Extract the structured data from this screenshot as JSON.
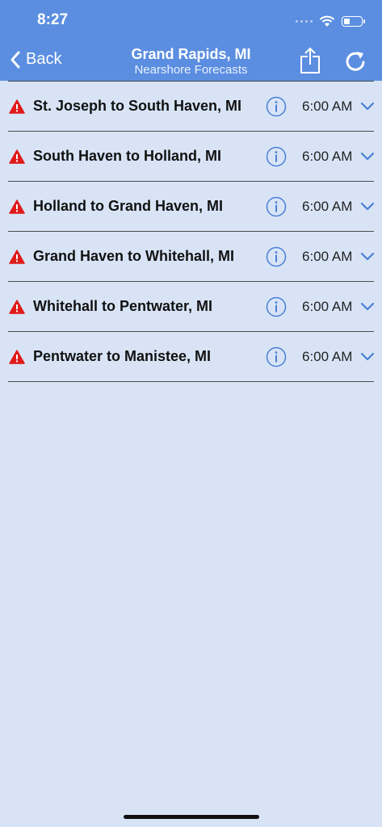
{
  "status_bar": {
    "time": "8:27",
    "battery_level": 0.35
  },
  "nav": {
    "back_label": "Back",
    "title": "Grand Rapids, MI",
    "subtitle": "Nearshore Forecasts"
  },
  "colors": {
    "header": "#5b8ee0",
    "background": "#d8e4f6",
    "accent": "#4a7fd6",
    "warning": "#e01b1b"
  },
  "forecasts": [
    {
      "label": "St. Joseph to South Haven, MI",
      "time": "6:00 AM",
      "icon": "warning-icon"
    },
    {
      "label": "South Haven to Holland, MI",
      "time": "6:00 AM",
      "icon": "warning-icon"
    },
    {
      "label": "Holland to Grand Haven, MI",
      "time": "6:00 AM",
      "icon": "warning-icon"
    },
    {
      "label": "Grand Haven to Whitehall, MI",
      "time": "6:00 AM",
      "icon": "warning-icon"
    },
    {
      "label": "Whitehall to Pentwater, MI",
      "time": "6:00 AM",
      "icon": "warning-icon"
    },
    {
      "label": "Pentwater to Manistee, MI",
      "time": "6:00 AM",
      "icon": "warning-icon"
    }
  ]
}
